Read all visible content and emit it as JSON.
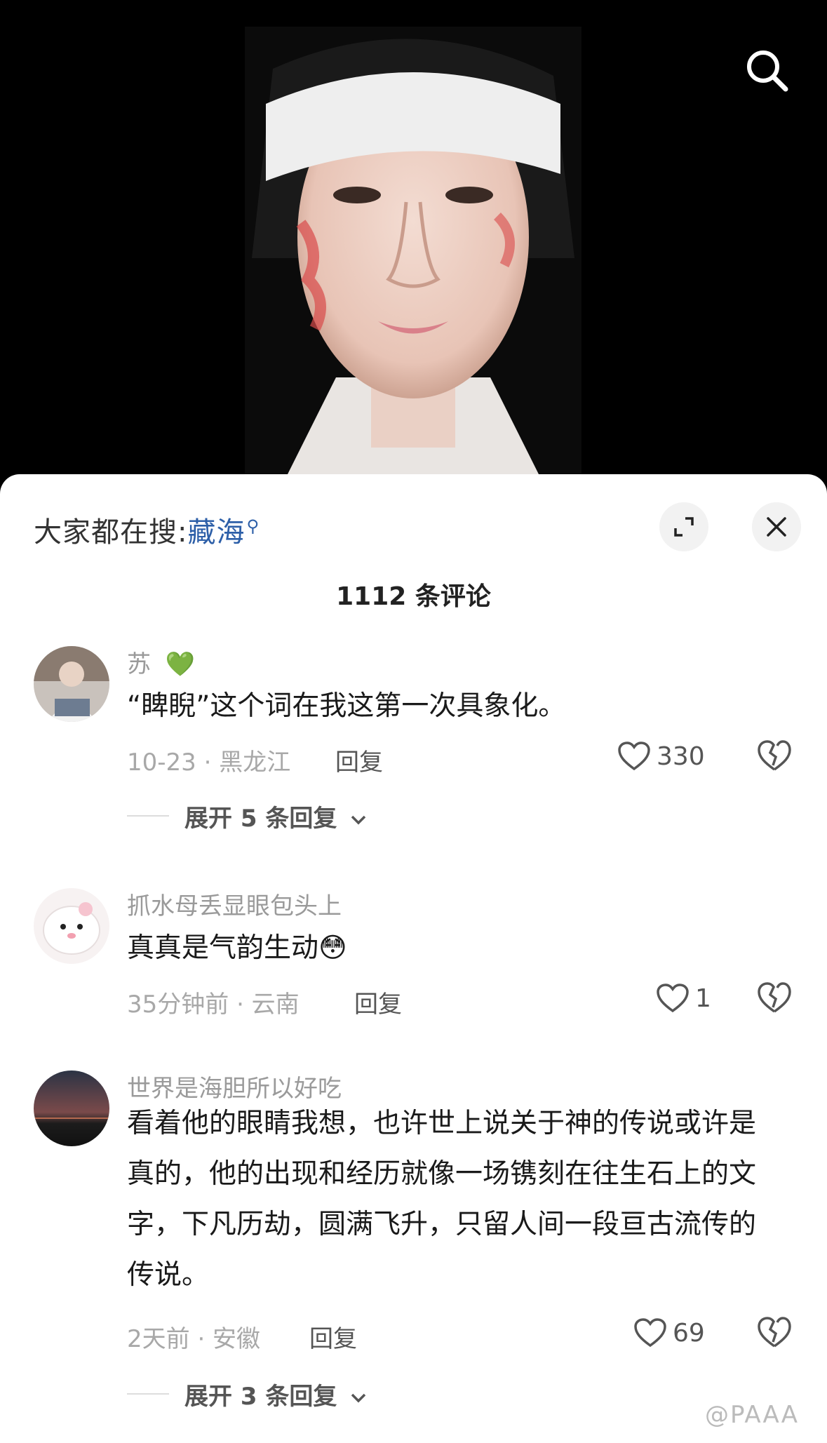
{
  "search": {
    "icon": "search-icon"
  },
  "sheet": {
    "hot_search_prefix": "大家都在搜:",
    "hot_search_keyword": "藏海",
    "comment_count": "1112 条评论"
  },
  "comments": [
    {
      "username": "苏",
      "badge": "💚",
      "text": "“睥睨”这个词在我这第一次具象化。",
      "meta": "10-23 · 黑龙江",
      "reply": "回复",
      "likes": "330",
      "expand": "展开 5 条回复"
    },
    {
      "username": "抓水母丢显眼包头上",
      "text": "真真是气韵生动😳",
      "meta": "35分钟前 · 云南",
      "reply": "回复",
      "likes": "1"
    },
    {
      "username": "世界是海胆所以好吃",
      "text": "看着他的眼睛我想，也许世上说关于神的传说或许是真的，他的出现和经历就像一场镌刻在往生石上的文字，下凡历劫，圆满飞升，只留人间一段亘古流传的传说。",
      "meta": "2天前 · 安徽",
      "reply": "回复",
      "likes": "69",
      "expand": "展开 3 条回复"
    }
  ],
  "watermark": "@PAAA"
}
